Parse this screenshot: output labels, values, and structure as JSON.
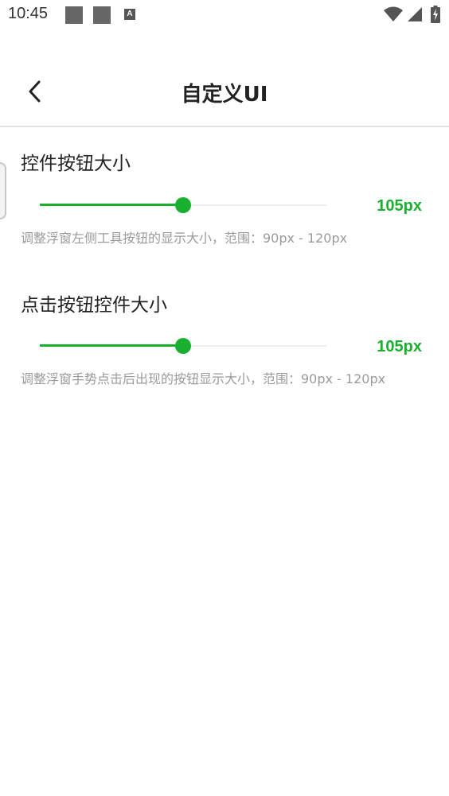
{
  "status_bar": {
    "time": "10:45",
    "notification_icons": [
      "square-notification-icon",
      "square-notification-icon",
      "a-app-icon"
    ],
    "a_icon_letter": "A",
    "system_icons": [
      "wifi-icon",
      "signal-icon",
      "battery-charging-icon"
    ]
  },
  "header": {
    "title": "自定义UI",
    "back_icon": "chevron-left-icon"
  },
  "settings": [
    {
      "title": "控件按钮大小",
      "value_label": "105px",
      "value": 105,
      "min": 90,
      "max": 120,
      "description": "调整浮窗左侧工具按钮的显示大小，范围：90px - 120px"
    },
    {
      "title": "点击按钮控件大小",
      "value_label": "105px",
      "value": 105,
      "min": 90,
      "max": 120,
      "description": "调整浮窗手势点击后出现的按钮显示大小，范围：90px - 120px"
    }
  ],
  "colors": {
    "accent": "#19b02f",
    "track": "#eeeeee",
    "description_text": "#9a9a9a",
    "title_text": "#222222"
  }
}
